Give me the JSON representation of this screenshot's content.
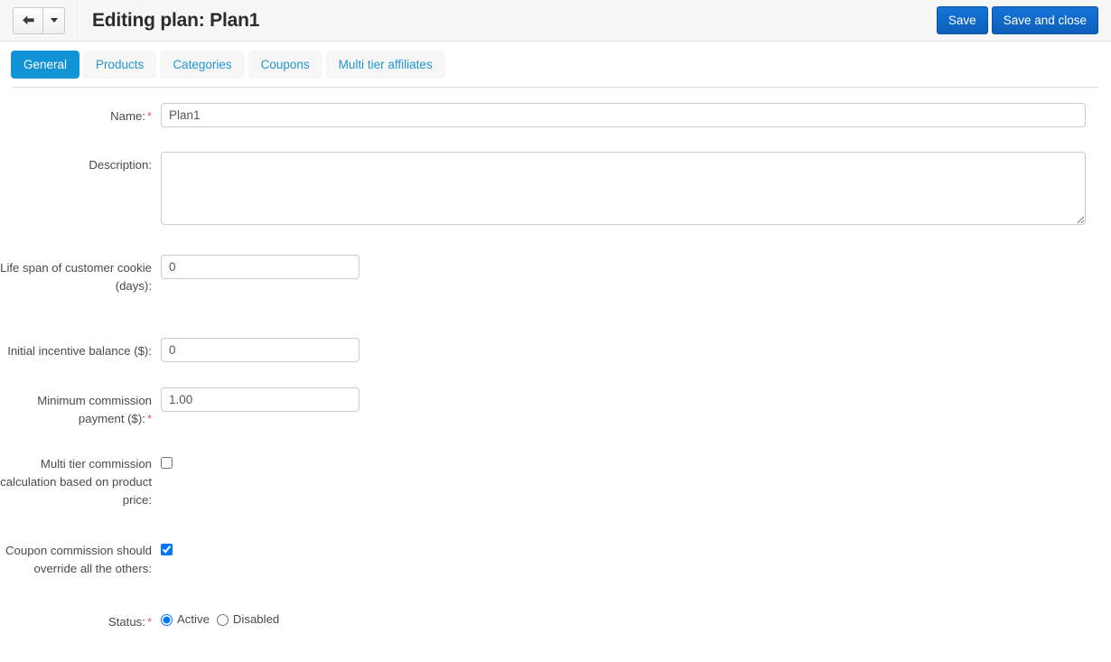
{
  "header": {
    "back_icon": "arrow-left-icon",
    "back_caret_icon": "caret-down-icon",
    "title": "Editing plan: Plan1",
    "buttons": {
      "save": "Save",
      "save_and_close": "Save and close"
    },
    "accent_color": "#0d5fba",
    "background": "#f7f7f7"
  },
  "tabs": {
    "active_color": "#1293d6",
    "link_color": "#2196d4",
    "items": [
      {
        "label": "General",
        "active": true
      },
      {
        "label": "Products",
        "active": false
      },
      {
        "label": "Categories",
        "active": false
      },
      {
        "label": "Coupons",
        "active": false
      },
      {
        "label": "Multi tier affiliates",
        "active": false
      }
    ]
  },
  "form": {
    "required_marker": "*",
    "required_color": "#e8566d",
    "fields": {
      "name": {
        "label": "Name:",
        "required": true,
        "value": "Plan1",
        "placeholder": ""
      },
      "description": {
        "label": "Description:",
        "required": false,
        "value": "",
        "placeholder": ""
      },
      "life_span": {
        "label": "Life span of customer cookie (days):",
        "required": false,
        "value": "0",
        "placeholder": ""
      },
      "initial_incentive": {
        "label": "Initial incentive balance ($):",
        "required": false,
        "value": "0",
        "placeholder": ""
      },
      "minimum_commission": {
        "label": "Minimum commission payment ($):",
        "required": true,
        "value": "1.00",
        "placeholder": ""
      },
      "multi_tier": {
        "label": "Multi tier commission calculation based on product price:",
        "required": false,
        "checked": false
      },
      "coupon_override": {
        "label": "Coupon commission should override all the others:",
        "required": false,
        "checked": true
      },
      "status": {
        "label": "Status:",
        "required": true,
        "selected": "Active",
        "options": [
          {
            "label": "Active",
            "selected": true
          },
          {
            "label": "Disabled",
            "selected": false
          }
        ]
      }
    }
  }
}
